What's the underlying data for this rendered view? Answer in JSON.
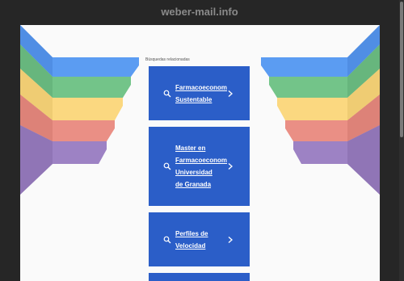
{
  "header": {
    "domain": "weber-mail.info"
  },
  "related": {
    "label": "Búsquedas relacionadas",
    "items": [
      {
        "lines": [
          "Farmacoeconomía",
          "Sustentable"
        ]
      },
      {
        "lines": [
          "Master en",
          "Farmacoeconomía",
          "Universidad",
          "de Granada"
        ]
      },
      {
        "lines": [
          "Perfiles de",
          "Velocidad"
        ]
      }
    ]
  },
  "colors": {
    "accent": "#2b5ec8",
    "stripe_blue": "#5b9cf2",
    "stripe_green": "#73c489",
    "stripe_yellow": "#fbd880",
    "stripe_red": "#ea8f85",
    "stripe_purple": "#9d82c4"
  },
  "icons": {
    "search": "search-icon",
    "chevron": "chevron-right-icon"
  }
}
